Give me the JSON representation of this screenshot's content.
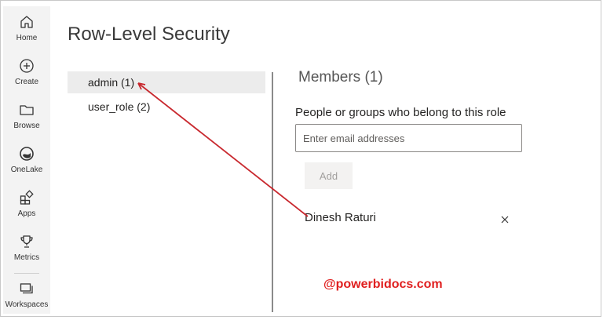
{
  "nav": {
    "items": [
      {
        "label": "Home",
        "icon": "home-icon"
      },
      {
        "label": "Create",
        "icon": "create-icon"
      },
      {
        "label": "Browse",
        "icon": "browse-icon"
      },
      {
        "label": "OneLake",
        "icon": "onelake-icon"
      },
      {
        "label": "Apps",
        "icon": "apps-icon"
      },
      {
        "label": "Metrics",
        "icon": "metrics-icon"
      },
      {
        "label": "Workspaces",
        "icon": "workspaces-icon"
      }
    ]
  },
  "page": {
    "title": "Row-Level Security"
  },
  "roles": {
    "items": [
      {
        "label": "admin (1)",
        "selected": true
      },
      {
        "label": "user_role (2)",
        "selected": false
      }
    ]
  },
  "members": {
    "heading": "Members (1)",
    "description": "People or groups who belong to this role",
    "input_placeholder": "Enter email addresses",
    "input_value": "",
    "add_label": "Add",
    "list": [
      {
        "name": "Dinesh Raturi",
        "remove_icon": "close-icon"
      }
    ]
  },
  "watermark": {
    "text": "@powerbidocs.com"
  },
  "colors": {
    "annotation_arrow": "#c8262c",
    "watermark": "#e02020",
    "selected_role_bg": "#ececec",
    "rail_bg": "#f3f3f3"
  }
}
